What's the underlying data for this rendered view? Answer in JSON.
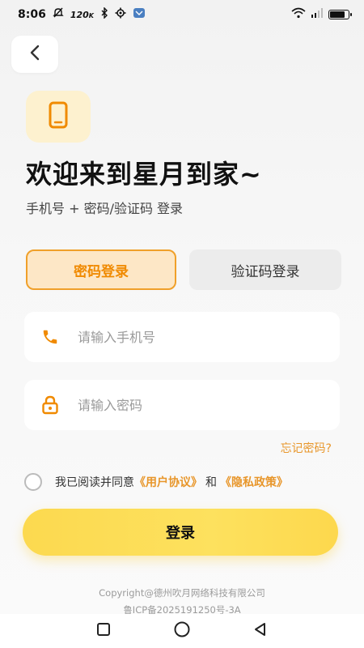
{
  "status_bar": {
    "time": "8:06",
    "speed": "120",
    "speed_unit": "K",
    "battery_level": 0.8
  },
  "header": {
    "back_icon": "chevron-left-icon"
  },
  "app_icon": "phone-icon",
  "title": "欢迎来到星月到家~",
  "subtitle": "手机号 + 密码/验证码 登录",
  "tabs": [
    {
      "label": "密码登录",
      "active": true
    },
    {
      "label": "验证码登录",
      "active": false
    }
  ],
  "phone_input": {
    "placeholder": "请输入手机号",
    "icon": "phone-handset-icon"
  },
  "password_input": {
    "placeholder": "请输入密码",
    "icon": "lock-icon"
  },
  "forgot_password": "忘记密码?",
  "agreement": {
    "prefix": "我已阅读并同意",
    "user_agreement": "《用户协议》",
    "and": "和",
    "privacy_policy": "《隐私政策》"
  },
  "login_button": "登录",
  "footer": {
    "copyright": "Copyright@德州吹月网络科技有限公司",
    "icp": "鲁ICP备2025191250号-3A"
  },
  "colors": {
    "accent": "#f08a00",
    "button": "#fdd84d",
    "tab_active_bg": "#fde7c6"
  }
}
